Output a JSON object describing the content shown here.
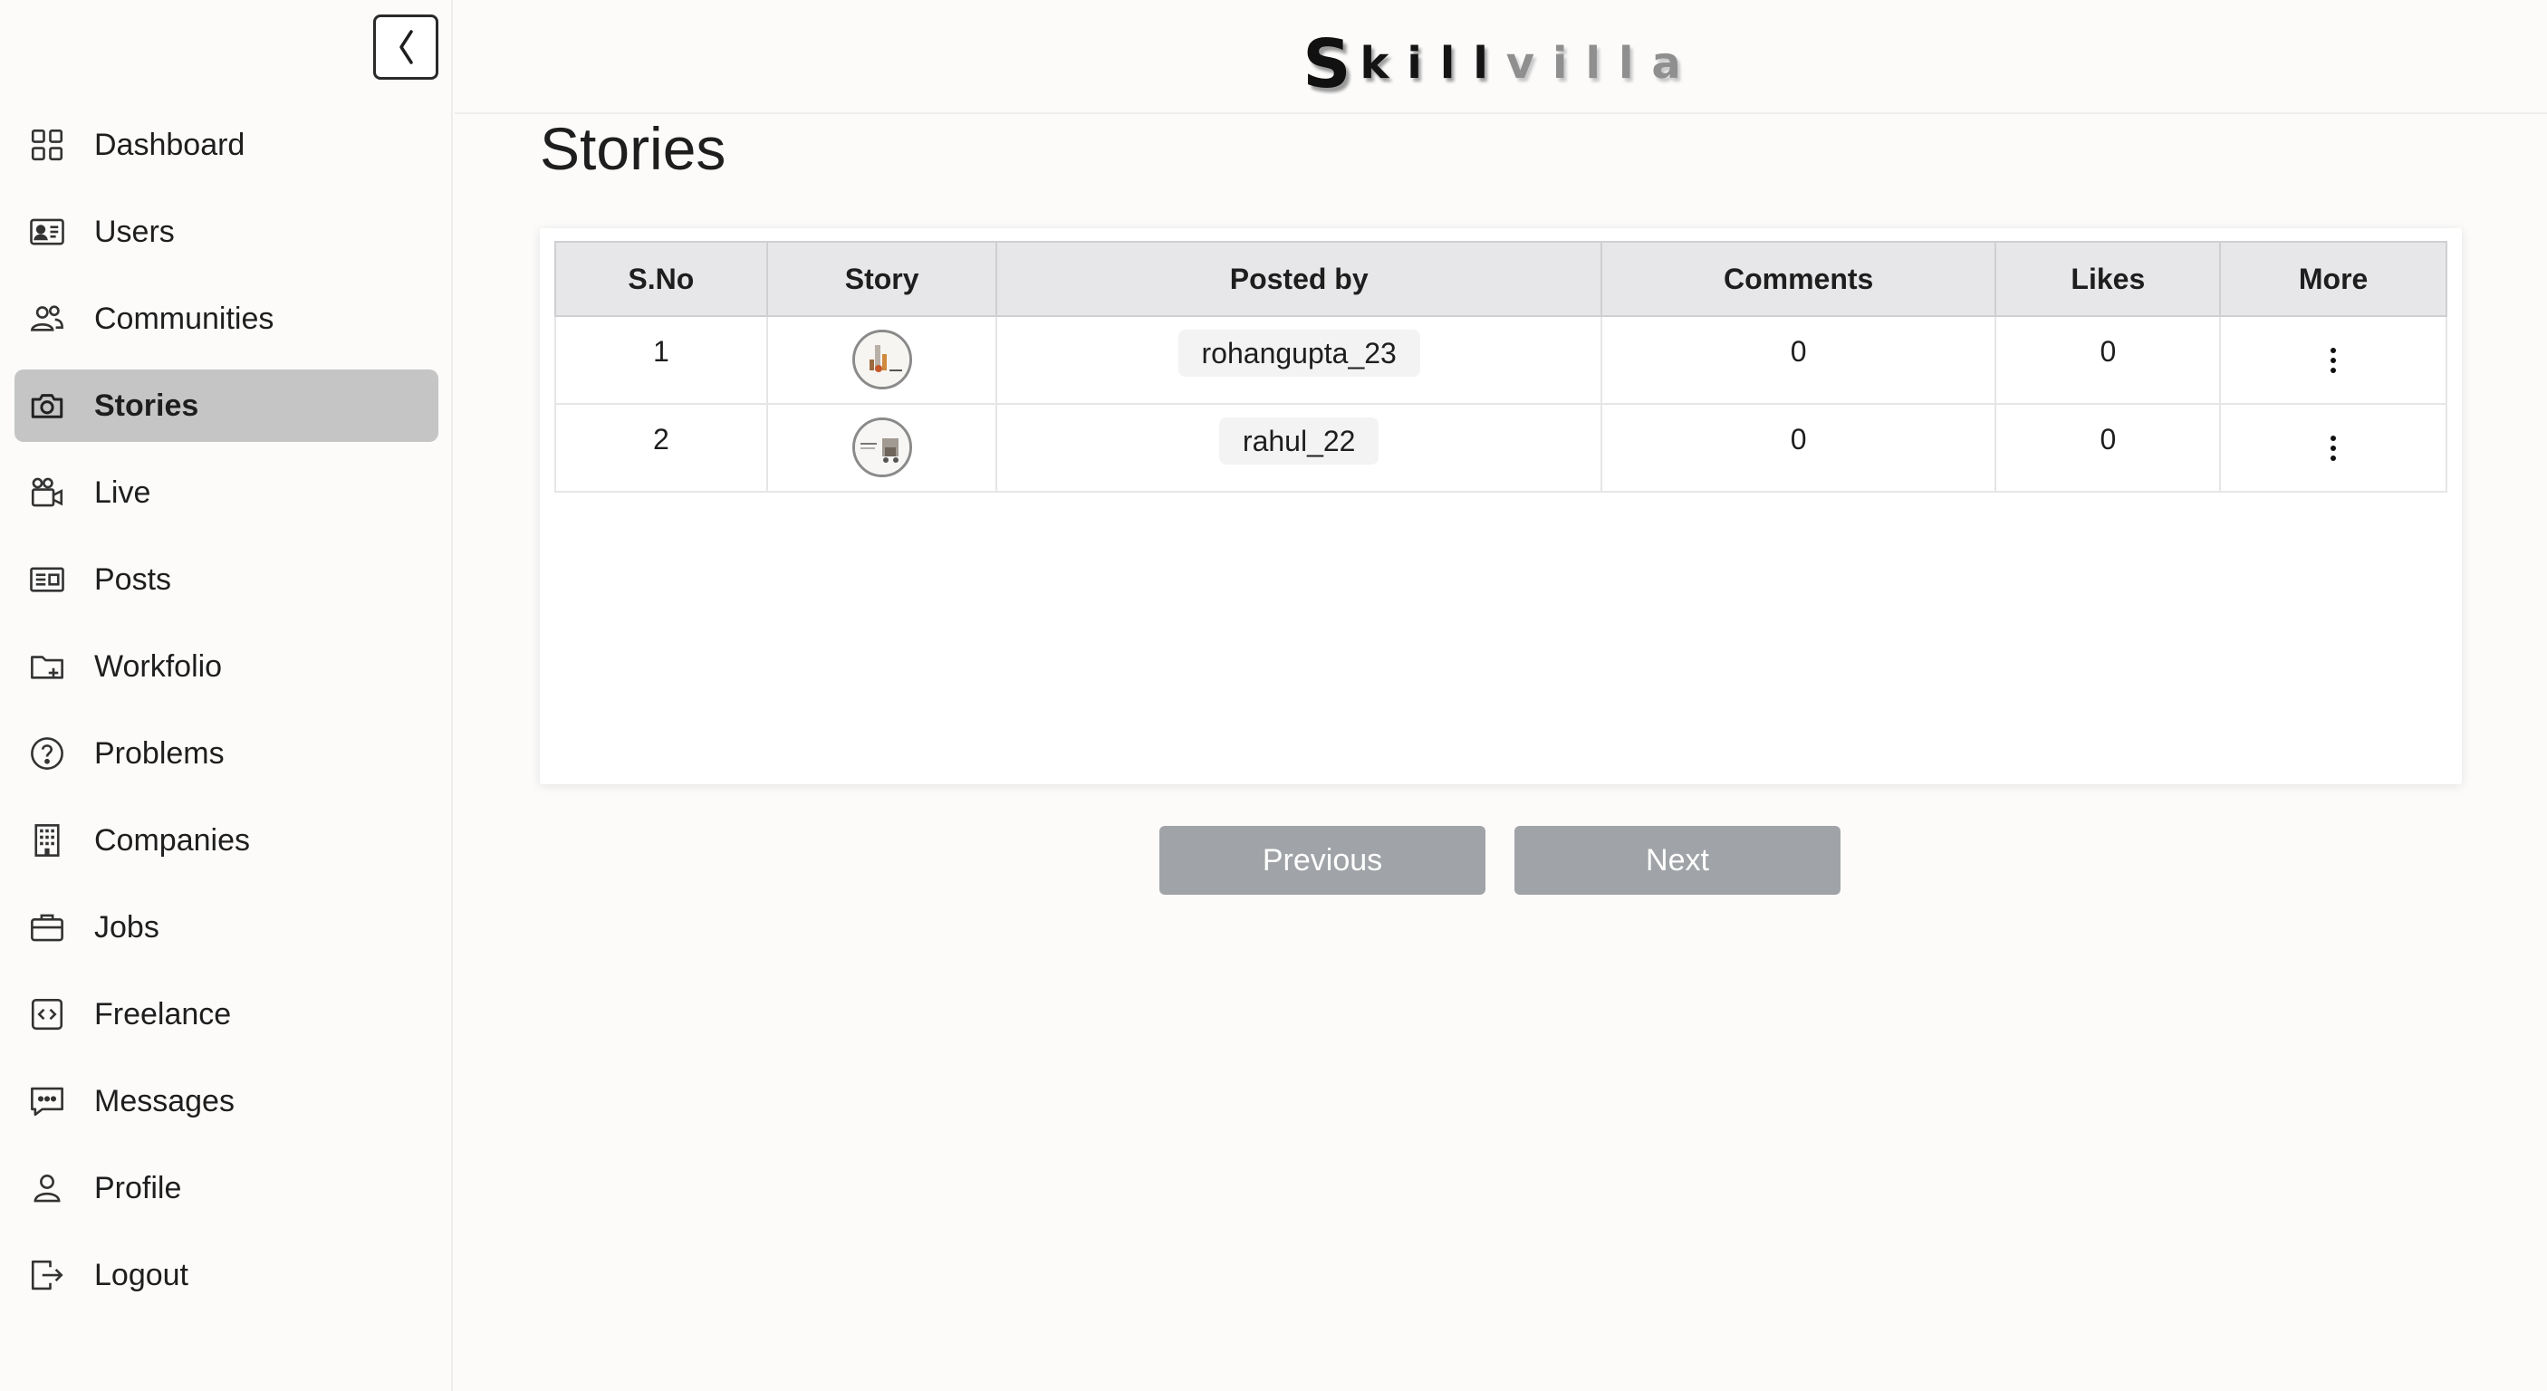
{
  "header": {
    "logo_s": "S",
    "logo_kill": "kill",
    "logo_villa": "villa"
  },
  "sidebar": {
    "collapse_label": "❬",
    "items": [
      {
        "label": "Dashboard",
        "icon": "grid-icon"
      },
      {
        "label": "Users",
        "icon": "id-card-icon"
      },
      {
        "label": "Communities",
        "icon": "people-icon"
      },
      {
        "label": "Stories",
        "icon": "camera-icon",
        "active": true
      },
      {
        "label": "Live",
        "icon": "video-camera-icon"
      },
      {
        "label": "Posts",
        "icon": "newspaper-icon"
      },
      {
        "label": "Workfolio",
        "icon": "folder-plus-icon"
      },
      {
        "label": "Problems",
        "icon": "question-circle-icon"
      },
      {
        "label": "Companies",
        "icon": "building-icon"
      },
      {
        "label": "Jobs",
        "icon": "briefcase-icon"
      },
      {
        "label": "Freelance",
        "icon": "code-icon"
      },
      {
        "label": "Messages",
        "icon": "chat-icon"
      },
      {
        "label": "Profile",
        "icon": "person-icon"
      },
      {
        "label": "Logout",
        "icon": "logout-icon"
      }
    ]
  },
  "main": {
    "title": "Stories",
    "table": {
      "headers": [
        "S.No",
        "Story",
        "Posted by",
        "Comments",
        "Likes",
        "More"
      ],
      "rows": [
        {
          "sno": "1",
          "posted_by": "rohangupta_23",
          "comments": "0",
          "likes": "0"
        },
        {
          "sno": "2",
          "posted_by": "rahul_22",
          "comments": "0",
          "likes": "0"
        }
      ]
    },
    "pagination": {
      "previous": "Previous",
      "next": "Next"
    }
  },
  "colors": {
    "background": "#fcfbfa",
    "active_nav": "#c5c5c5",
    "table_header": "#e7e7e9",
    "pager_button": "#a0a3a7"
  }
}
